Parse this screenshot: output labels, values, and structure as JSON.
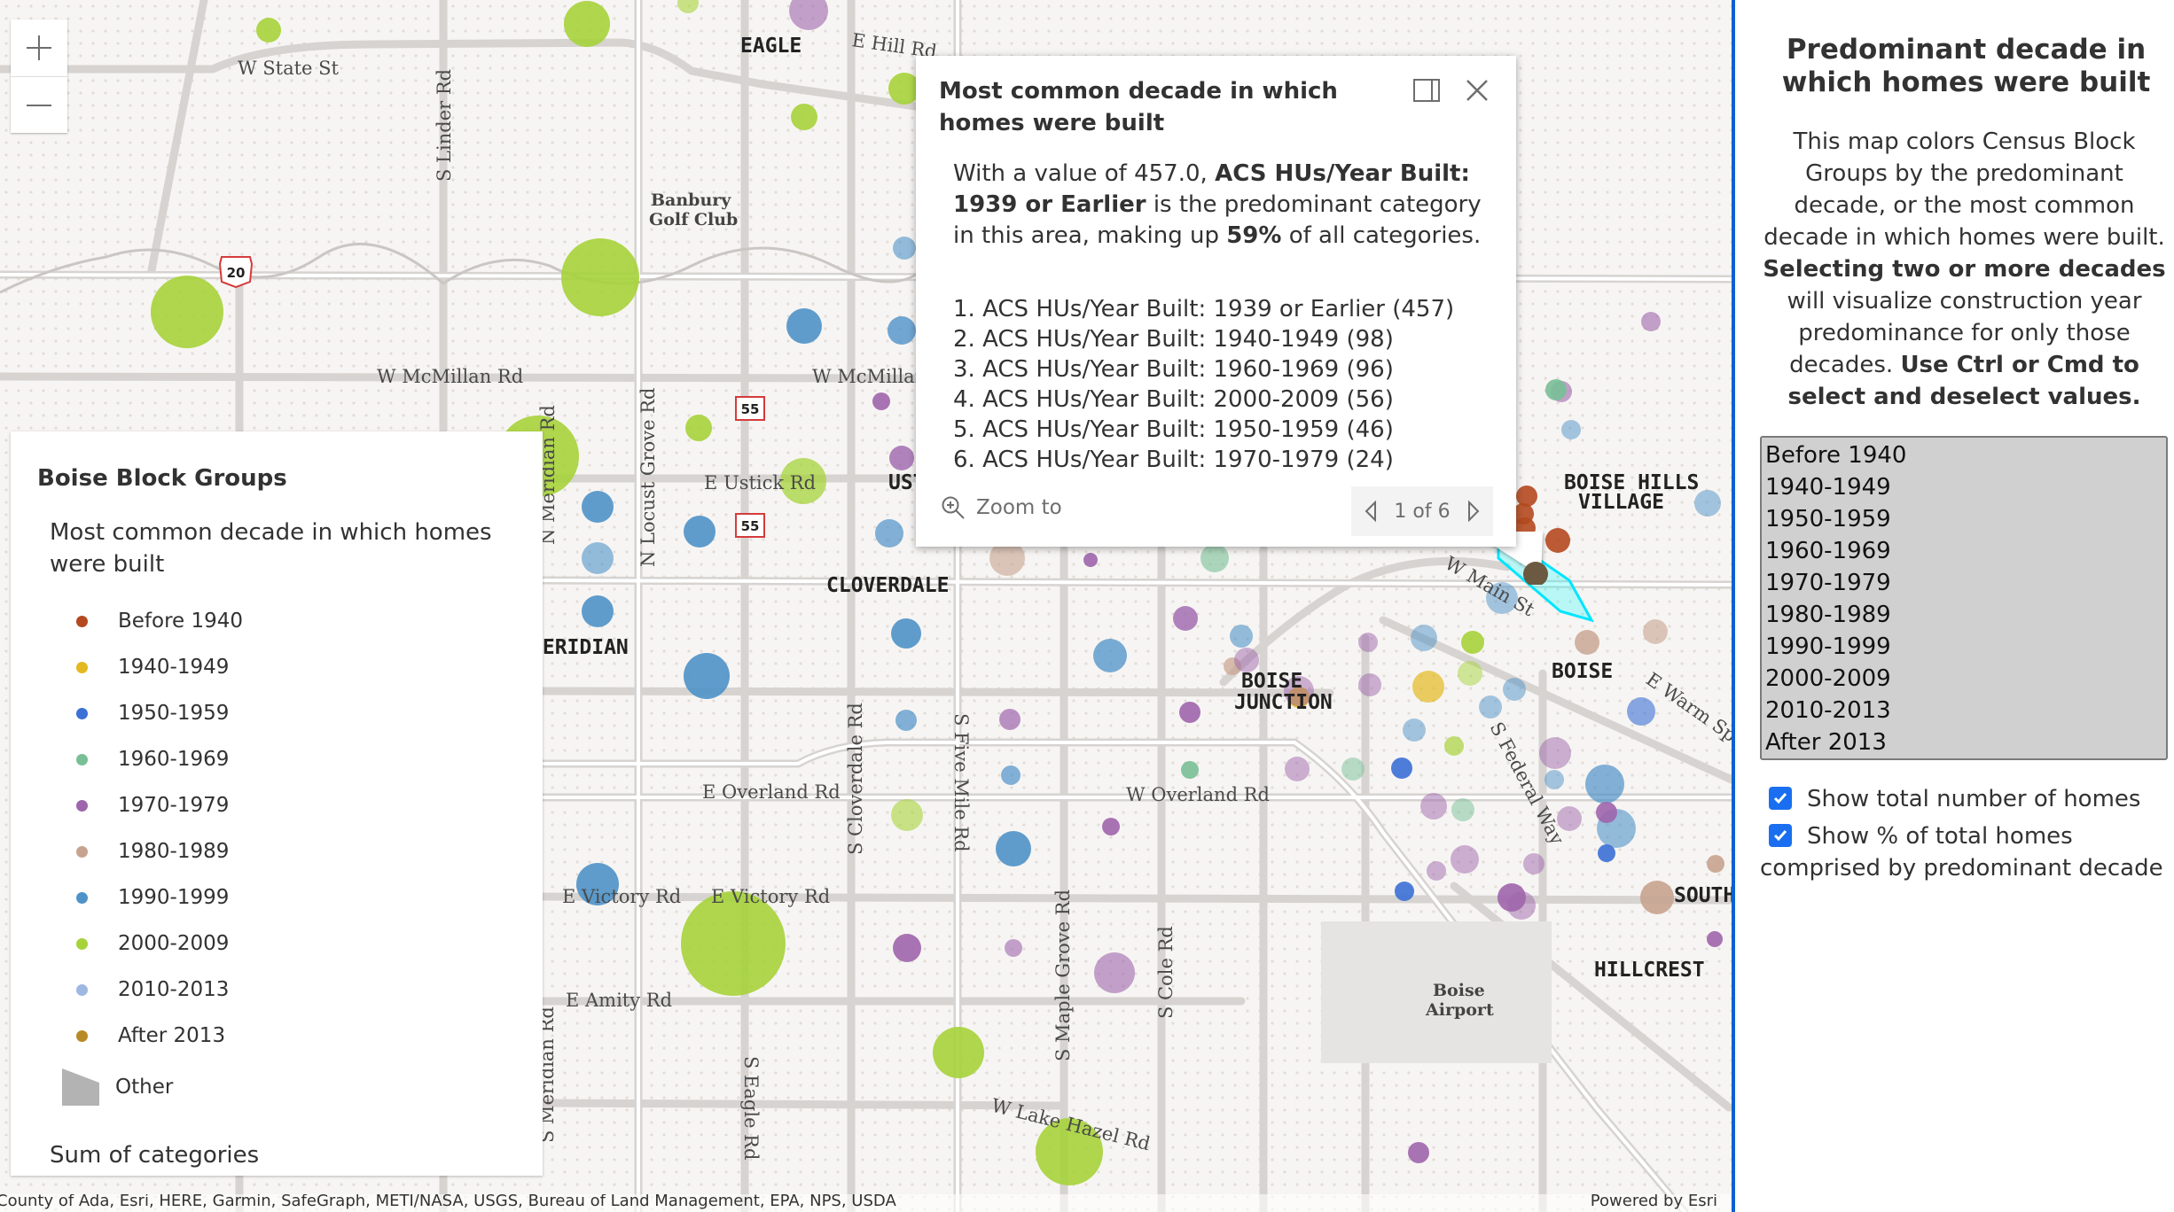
{
  "colors": {
    "before1940": "#b4491f",
    "d1940": "#e3b91f",
    "d1950": "#3b70d6",
    "d1960": "#78bf96",
    "d1970": "#9e65ac",
    "d1980": "#c7a38f",
    "d1990": "#4e92c8",
    "d2000": "#a6d33a",
    "d2010": "#9fb7e3",
    "after2013": "#b88a26",
    "other": "#b3b3b3",
    "accent": "#0b61d2",
    "highlight": "#00ffff"
  },
  "zoom": {
    "in_icon": "plus-icon",
    "out_icon": "minus-icon"
  },
  "map": {
    "place_labels": [
      "EAGLE",
      "CLOVERDALE",
      "MERIDIAN",
      "BOISE JUNCTION",
      "BOISE HILLS VILLAGE",
      "BOISE",
      "SOUTH",
      "HILLCREST",
      "USTICK"
    ],
    "road_labels": [
      "W State St",
      "E Hill Rd",
      "S Linder Rd",
      "W McMillan Rd",
      "W McMillan",
      "N Locust Grove Rd",
      "N Meridian Rd",
      "E Ustick Rd",
      "E Overland Rd",
      "W Overland Rd",
      "S Cloverdale Rd",
      "S Five Mile Rd",
      "E Victory Rd",
      "E Amity Rd",
      "S Maple Grove Rd",
      "S Cole Rd",
      "S Eagle Rd",
      "S Meridian Rd",
      "W Lake Hazel Rd",
      "W Main St",
      "S Federal Way",
      "E Warm Springs"
    ],
    "poi_labels": [
      "Banbury Golf Club",
      "Boise Airport"
    ],
    "shields": [
      "20",
      "55",
      "55"
    ]
  },
  "legend": {
    "layer_title": "Boise Block Groups",
    "subtitle": "Most common decade in which homes were built",
    "items": [
      {
        "label": "Before 1940",
        "color": "#b4491f"
      },
      {
        "label": "1940-1949",
        "color": "#e3b91f"
      },
      {
        "label": "1950-1959",
        "color": "#3b70d6"
      },
      {
        "label": "1960-1969",
        "color": "#78bf96"
      },
      {
        "label": "1970-1979",
        "color": "#9e65ac"
      },
      {
        "label": "1980-1989",
        "color": "#c7a38f"
      },
      {
        "label": "1990-1999",
        "color": "#4e92c8"
      },
      {
        "label": "2000-2009",
        "color": "#a6d33a"
      },
      {
        "label": "2010-2013",
        "color": "#9fb7e3"
      },
      {
        "label": "After 2013",
        "color": "#b88a26"
      }
    ],
    "other_label": "Other",
    "size_label": "Sum of categories"
  },
  "popup": {
    "title": "Most common decade in which homes were built",
    "intro_prefix": "With a value of 457.0, ",
    "intro_bold_category": "ACS HUs/Year Built: 1939 or Earlier",
    "intro_middle": " is the predominant category in this area, making up ",
    "intro_bold_percent": "59%",
    "intro_suffix": " of all categories.",
    "ranked": [
      "1. ACS HUs/Year Built: 1939 or Earlier (457)",
      "2. ACS HUs/Year Built: 1940-1949 (98)",
      "3. ACS HUs/Year Built: 1960-1969 (96)",
      "4. ACS HUs/Year Built: 2000-2009 (56)",
      "5. ACS HUs/Year Built: 1950-1959 (46)",
      "6. ACS HUs/Year Built: 1970-1979 (24)"
    ],
    "zoom_to_label": "Zoom to",
    "pager_text": "1 of 6",
    "current_feature": 1,
    "total_features": 6
  },
  "attribution": {
    "left": "County of Ada, Esri, HERE, Garmin, SafeGraph, METI/NASA, USGS, Bureau of Land Management, EPA, NPS, USDA",
    "right": "Powered by Esri"
  },
  "panel": {
    "title": "Predominant decade in which homes were built",
    "desc_1": "This map colors Census Block Groups by the predominant decade, or the most common decade in which homes were built. ",
    "desc_bold_1": "Selecting two or more decades",
    "desc_2": " will visualize construction year predominance for only those decades. ",
    "desc_bold_2": "Use Ctrl or Cmd to select and deselect values.",
    "decade_options": [
      "Before 1940",
      "1940-1949",
      "1950-1959",
      "1960-1969",
      "1970-1979",
      "1980-1989",
      "1990-1999",
      "2000-2009",
      "2010-2013",
      "After 2013"
    ],
    "checkbox_total": {
      "label": "Show total number of homes",
      "checked": true
    },
    "checkbox_percent": {
      "label": "Show % of total homes comprised by predominant decade",
      "checked": true
    }
  }
}
